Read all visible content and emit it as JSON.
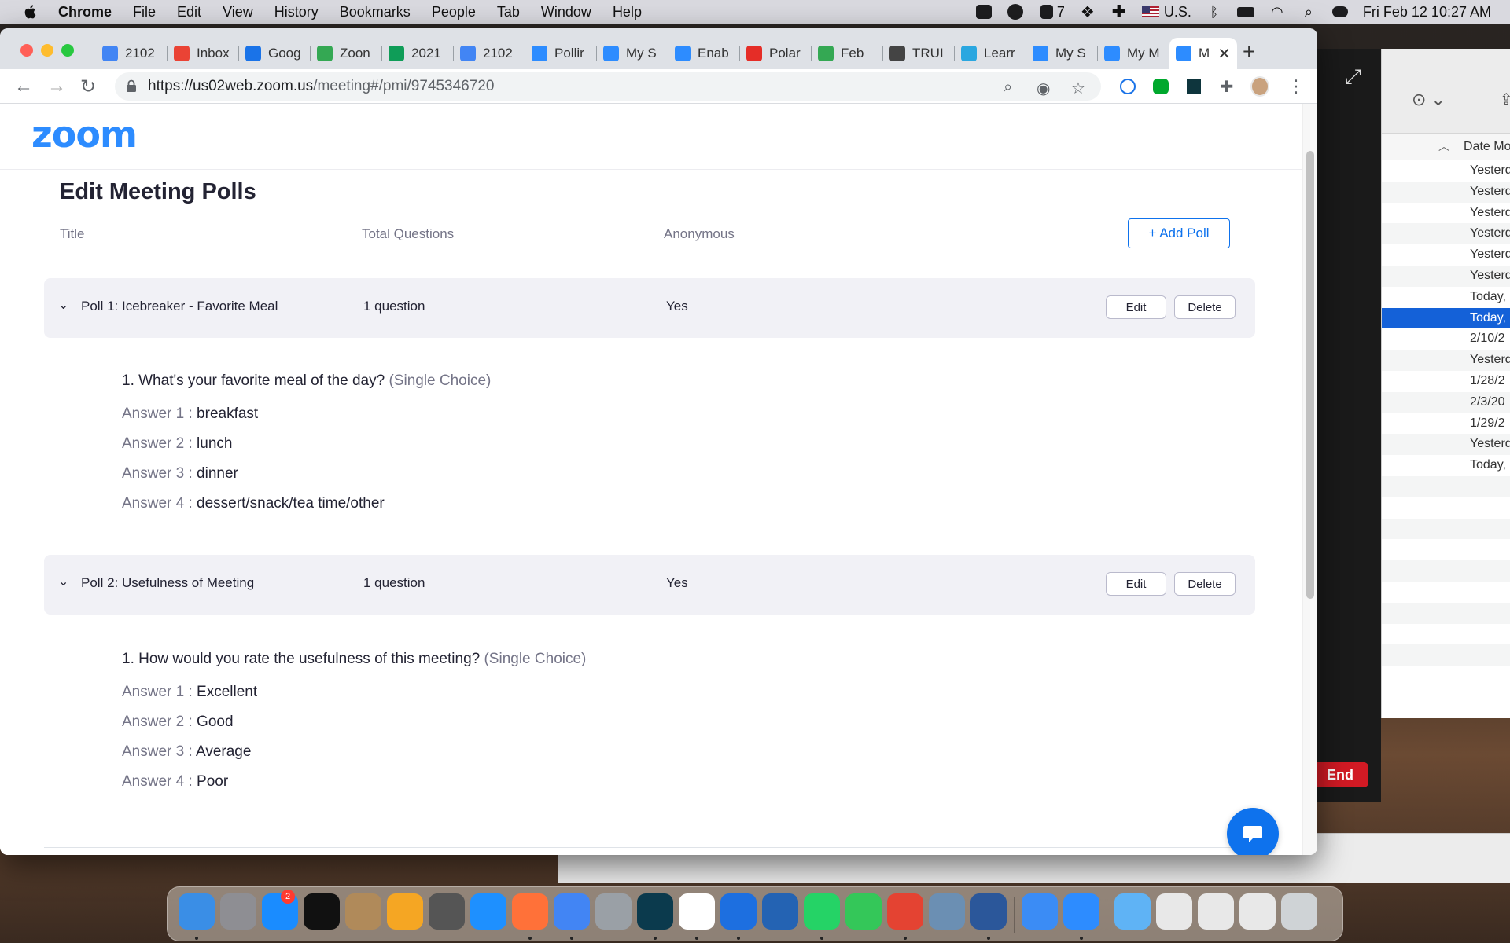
{
  "menubar": {
    "items": [
      "Chrome",
      "File",
      "Edit",
      "View",
      "History",
      "Bookmarks",
      "People",
      "Tab",
      "Window",
      "Help"
    ],
    "battery_count": "7",
    "input_source": "U.S.",
    "datetime": "Fri Feb 12  10:27 AM"
  },
  "tabs": [
    {
      "label": "2102",
      "icon": "google-docs-icon",
      "color": "#4285f4"
    },
    {
      "label": "Inbox",
      "icon": "gmail-icon",
      "color": "#ea4335"
    },
    {
      "label": "Goog",
      "icon": "google-calendar-icon",
      "color": "#1a73e8"
    },
    {
      "label": "Zoon",
      "icon": "google-drive-icon",
      "color": "#34a853"
    },
    {
      "label": "2021",
      "icon": "google-sheets-icon",
      "color": "#0f9d58"
    },
    {
      "label": "2102",
      "icon": "google-docs-icon",
      "color": "#4285f4"
    },
    {
      "label": "Pollir",
      "icon": "zoom-icon",
      "color": "#2d8cff"
    },
    {
      "label": "My S",
      "icon": "zoom-icon",
      "color": "#2d8cff"
    },
    {
      "label": "Enab",
      "icon": "zoom-icon",
      "color": "#2d8cff"
    },
    {
      "label": "Polar",
      "icon": "polar-icon",
      "color": "#e52d27"
    },
    {
      "label": "Feb",
      "icon": "google-drive-icon",
      "color": "#34a853"
    },
    {
      "label": "TRUI",
      "icon": "true-icon",
      "color": "#444"
    },
    {
      "label": "Learr",
      "icon": "learn-icon",
      "color": "#2aa7e0"
    },
    {
      "label": "My S",
      "icon": "zoom-icon",
      "color": "#2d8cff"
    },
    {
      "label": "My M",
      "icon": "zoom-icon",
      "color": "#2d8cff"
    },
    {
      "label": "M",
      "icon": "zoom-icon",
      "color": "#2d8cff"
    }
  ],
  "url": {
    "host": "https://us02web.zoom.us",
    "path": "/meeting#/pmi/9745346720"
  },
  "page": {
    "logo": "zoom",
    "title": "Edit Meeting Polls",
    "columns": {
      "title": "Title",
      "questions": "Total Questions",
      "anonymous": "Anonymous"
    },
    "add_poll": "+ Add Poll",
    "edit_label": "Edit",
    "delete_label": "Delete",
    "polls": [
      {
        "title": "Poll 1: Icebreaker - Favorite Meal",
        "questions": "1 question",
        "anonymous": "Yes",
        "question": "1. What's your favorite meal of the day?",
        "type": "(Single Choice)",
        "answers": [
          {
            "label": "Answer 1 :",
            "value": "breakfast"
          },
          {
            "label": "Answer 2 :",
            "value": "lunch"
          },
          {
            "label": "Answer 3 :",
            "value": "dinner"
          },
          {
            "label": "Answer 4 :",
            "value": "dessert/snack/tea time/other"
          }
        ]
      },
      {
        "title": "Poll 2: Usefulness of Meeting",
        "questions": "1 question",
        "anonymous": "Yes",
        "question": "1. How would you rate the usefulness of this meeting?",
        "type": "(Single Choice)",
        "answers": [
          {
            "label": "Answer 1 :",
            "value": "Excellent"
          },
          {
            "label": "Answer 2 :",
            "value": "Good"
          },
          {
            "label": "Answer 3 :",
            "value": "Average"
          },
          {
            "label": "Answer 4 :",
            "value": "Poor"
          }
        ]
      }
    ]
  },
  "zoom_window": {
    "end_label": "End"
  },
  "finder": {
    "column": "Date Mo",
    "rows": [
      "Yesterd",
      "Yesterd",
      "Yesterd",
      "Yesterd",
      "Yesterd",
      "Yesterd",
      "Today,",
      "Today,",
      "2/10/2",
      "Yesterd",
      "1/28/2",
      "2/3/20",
      "1/29/2",
      "Yesterd",
      "Today,"
    ]
  },
  "dock": {
    "appstore_badge": "2",
    "apps": [
      {
        "name": "finder-icon",
        "color": "#3a8ee6"
      },
      {
        "name": "system-preferences-icon",
        "color": "#8e8e93"
      },
      {
        "name": "app-store-icon",
        "color": "#1a8cff"
      },
      {
        "name": "apple-tv-icon",
        "color": "#111111"
      },
      {
        "name": "contacts-icon",
        "color": "#b08a5a"
      },
      {
        "name": "photos-icon",
        "color": "#f5a623"
      },
      {
        "name": "calculator-icon",
        "color": "#555555"
      },
      {
        "name": "safari-icon",
        "color": "#1e90ff"
      },
      {
        "name": "firefox-icon",
        "color": "#ff7139"
      },
      {
        "name": "chrome-icon",
        "color": "#4285f4"
      },
      {
        "name": "evernote-icon",
        "color": "#9aa0a6"
      },
      {
        "name": "dashlane-icon",
        "color": "#0b3a4d"
      },
      {
        "name": "slack-icon",
        "color": "#ffffff"
      },
      {
        "name": "jamf-icon",
        "color": "#1d6fe0"
      },
      {
        "name": "mountain-icon",
        "color": "#2463b3"
      },
      {
        "name": "whatsapp-icon",
        "color": "#25d366"
      },
      {
        "name": "messages-icon",
        "color": "#34c759"
      },
      {
        "name": "todoist-icon",
        "color": "#e44332"
      },
      {
        "name": "preview-icon",
        "color": "#6b8fb3"
      },
      {
        "name": "word-icon",
        "color": "#2b579a"
      },
      {
        "name": "mail-icon",
        "color": "#3b8cf5"
      },
      {
        "name": "zoom-icon",
        "color": "#2d8cff"
      },
      {
        "name": "downloads-folder-icon",
        "color": "#5fb3f5"
      },
      {
        "name": "stack-icon",
        "color": "#e8e8e8"
      },
      {
        "name": "stack-icon",
        "color": "#e8e8e8"
      },
      {
        "name": "stack-icon",
        "color": "#e8e8e8"
      },
      {
        "name": "trash-icon",
        "color": "#cfd3d6"
      }
    ]
  }
}
